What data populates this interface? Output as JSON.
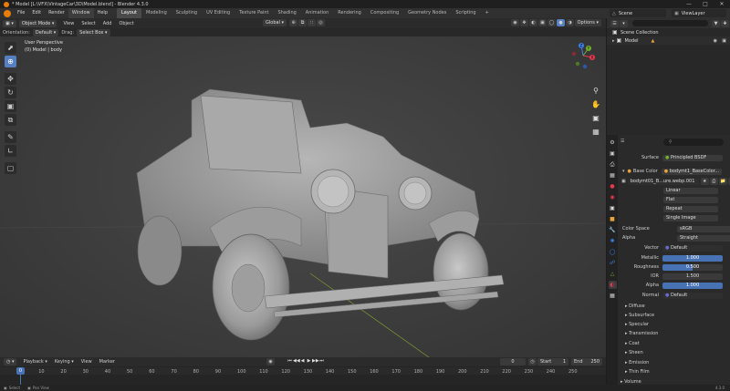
{
  "window": {
    "title": "* Model [L:\\VFX\\VintageCar\\3D\\Model.blend] - Blender 4.3.0",
    "controls": [
      "—",
      "□",
      "✕"
    ]
  },
  "menubar": {
    "menus": [
      "File",
      "Edit",
      "Render",
      "Window",
      "Help"
    ],
    "workspaces": [
      "Layout",
      "Modeling",
      "Sculpting",
      "UV Editing",
      "Texture Paint",
      "Shading",
      "Animation",
      "Rendering",
      "Compositing",
      "Geometry Nodes",
      "Scripting",
      "+"
    ],
    "scene": "Scene",
    "view_layer": "ViewLayer"
  },
  "viewport_header": {
    "mode": "Object Mode",
    "menus": [
      "View",
      "Select",
      "Add",
      "Object"
    ],
    "transform": "Global",
    "options": "Options"
  },
  "tool_header": {
    "orientation_label": "Orientation:",
    "orientation_value": "Default",
    "drag_label": "Drag:",
    "drag_value": "Select Box"
  },
  "viewport": {
    "view_name": "User Perspective",
    "collection": "(0) Model | body",
    "gizmo": {
      "x": "X",
      "y": "Y",
      "z": "Z"
    },
    "colors": {
      "x": "#e8384d",
      "y": "#6fb12d",
      "z": "#3d7fe8",
      "bg": "#3d3d3d"
    }
  },
  "outliner": {
    "rows": [
      {
        "label": "Scene Collection",
        "icon": "collection-icon"
      },
      {
        "label": "Model",
        "icon": "collection-icon"
      }
    ]
  },
  "properties": {
    "search_placeholder": "",
    "surface_label": "Surface",
    "surface_value": "Principled BSDF",
    "base_color_label": "Base Color",
    "base_color_value": "bodymt1_BaseColor...",
    "image_name": "bodymt01_B...ure.webp.001",
    "interp": "Linear",
    "projection": "Flat",
    "extension": "Repeat",
    "source": "Single Image",
    "color_space_label": "Color Space",
    "color_space_value": "sRGB",
    "alpha_label": "Alpha",
    "alpha_value": "Straight",
    "vector_label": "Vector",
    "vector_value": "Default",
    "metallic_label": "Metallic",
    "metallic_value": "1.000",
    "roughness_label": "Roughness",
    "roughness_value": "0.500",
    "ior_label": "IOR",
    "ior_value": "1.500",
    "alpha2_label": "Alpha",
    "alpha2_value": "1.000",
    "normal_label": "Normal",
    "normal_value": "Default",
    "sections": [
      "Diffuse",
      "Subsurface",
      "Specular",
      "Transmission",
      "Coat",
      "Sheen",
      "Emission",
      "Thin Film"
    ],
    "bottom_section": "Volume"
  },
  "timeline": {
    "menus": [
      "Playback",
      "Keying",
      "View",
      "Marker"
    ],
    "current_frame": "0",
    "start_label": "Start",
    "start_value": "1",
    "end_label": "End",
    "end_value": "250",
    "ticks": [
      "0",
      "10",
      "20",
      "30",
      "40",
      "50",
      "60",
      "70",
      "80",
      "90",
      "100",
      "110",
      "120",
      "130",
      "140",
      "150",
      "160",
      "170",
      "180",
      "190",
      "200",
      "210",
      "220",
      "230",
      "240",
      "250"
    ],
    "cursor_value": "0"
  },
  "statusbar": {
    "left": "Select",
    "middle": "Pan View",
    "version": "4.3.0"
  }
}
